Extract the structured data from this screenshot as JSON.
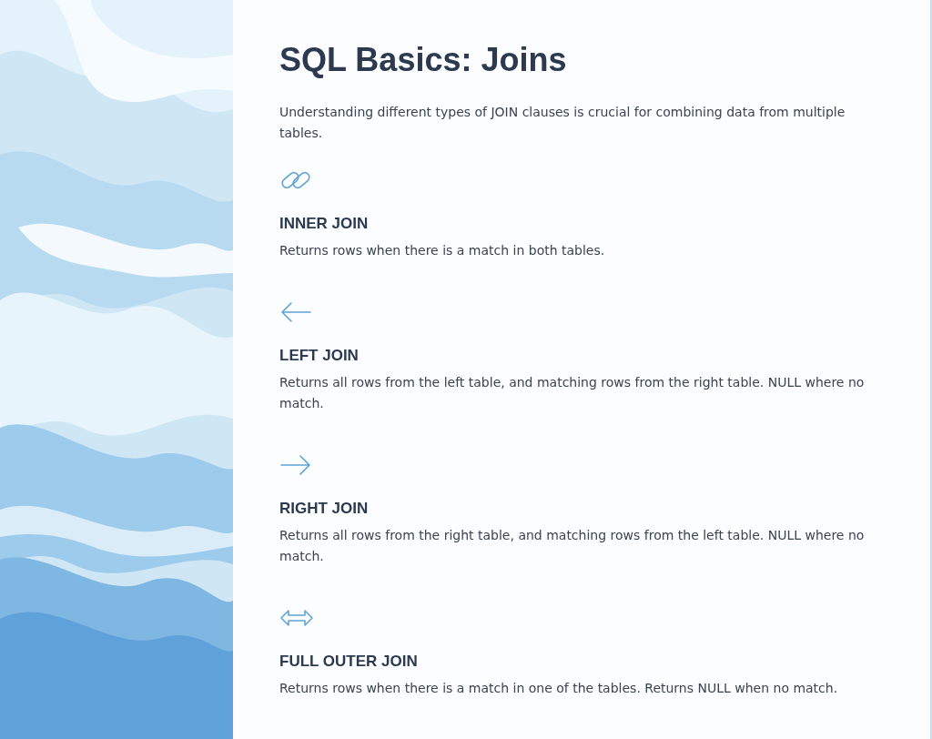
{
  "slide": {
    "title": "SQL Basics: Joins",
    "intro": "Understanding different types of JOIN clauses is crucial for combining data from multiple tables.",
    "items": [
      {
        "kind": "link",
        "heading": "INNER JOIN",
        "text": "Returns rows when there is a match in both tables."
      },
      {
        "kind": "arrow-left",
        "heading": "LEFT JOIN",
        "text": "Returns all rows from the left table, and matching rows from the right table. NULL where no match."
      },
      {
        "kind": "arrow-right",
        "heading": "RIGHT JOIN",
        "text": "Returns all rows from the right table, and matching rows from the left table. NULL where no match."
      },
      {
        "kind": "arrow-both",
        "heading": "FULL OUTER JOIN",
        "text": "Returns rows when there is a match in one of the tables. Returns NULL when no match."
      }
    ]
  }
}
